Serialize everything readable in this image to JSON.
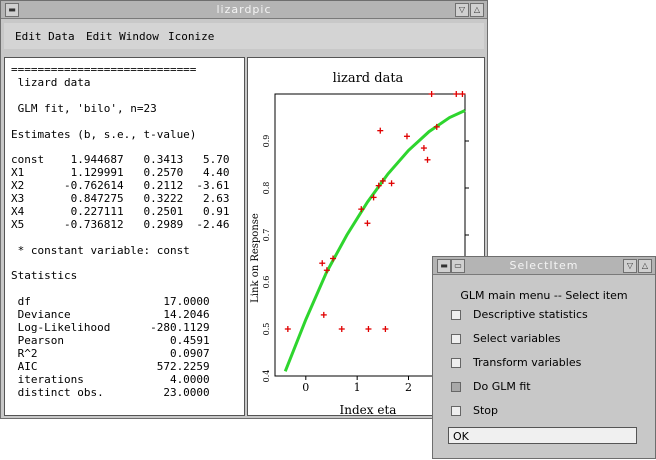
{
  "main_window": {
    "title": "lizardpic",
    "titlebar_buttons": [
      "▽",
      "△"
    ],
    "menu": [
      "Edit Data",
      "Edit Window",
      "Iconize"
    ]
  },
  "text_panel": {
    "lines": [
      "============================",
      " lizard data",
      "",
      " GLM fit, 'bilo', n=23",
      "",
      "Estimates (b, s.e., t-value)",
      "",
      "const    1.944687   0.3413   5.70",
      "X1       1.129991   0.2570   4.40",
      "X2      -0.762614   0.2112  -3.61",
      "X3       0.847275   0.3222   2.63",
      "X4       0.227111   0.2501   0.91",
      "X5      -0.736812   0.2989  -2.46",
      "",
      " * constant variable: const",
      "",
      "Statistics",
      "",
      " df                    17.0000",
      " Deviance              14.2046",
      " Log-Likelihood      -280.1129",
      " Pearson                0.4591",
      " R^2                    0.0907",
      " AIC                  572.2259",
      " iterations             4.0000",
      " distinct obs.         23.0000"
    ]
  },
  "chart_data": {
    "type": "scatter",
    "title": "lizard data",
    "xlabel": "Index eta",
    "ylabel": "Link on Response",
    "xlim": [
      -0.6,
      3.1
    ],
    "ylim": [
      0.4,
      1.0
    ],
    "x_ticks": [
      0,
      1,
      2
    ],
    "y_ticks": [
      0.4,
      0.5,
      0.6,
      0.7,
      0.8,
      0.9
    ],
    "points": [
      {
        "x": -0.35,
        "y": 0.5
      },
      {
        "x": 0.32,
        "y": 0.64
      },
      {
        "x": 0.35,
        "y": 0.53
      },
      {
        "x": 0.41,
        "y": 0.625
      },
      {
        "x": 0.53,
        "y": 0.65
      },
      {
        "x": 0.7,
        "y": 0.5
      },
      {
        "x": 1.08,
        "y": 0.755
      },
      {
        "x": 1.2,
        "y": 0.725
      },
      {
        "x": 1.22,
        "y": 0.5
      },
      {
        "x": 1.32,
        "y": 0.78
      },
      {
        "x": 1.42,
        "y": 0.805
      },
      {
        "x": 1.45,
        "y": 0.922
      },
      {
        "x": 1.5,
        "y": 0.815
      },
      {
        "x": 1.55,
        "y": 0.5
      },
      {
        "x": 1.67,
        "y": 0.81
      },
      {
        "x": 1.97,
        "y": 0.91
      },
      {
        "x": 2.3,
        "y": 0.885
      },
      {
        "x": 2.37,
        "y": 0.86
      },
      {
        "x": 2.45,
        "y": 1.0
      },
      {
        "x": 2.55,
        "y": 0.93
      },
      {
        "x": 2.93,
        "y": 1.0
      },
      {
        "x": 3.05,
        "y": 1.0
      }
    ],
    "fit_line": {
      "x": [
        -0.4,
        0.0,
        0.4,
        0.8,
        1.2,
        1.6,
        2.0,
        2.4,
        2.8,
        3.1
      ],
      "y": [
        0.41,
        0.52,
        0.62,
        0.7,
        0.77,
        0.83,
        0.88,
        0.92,
        0.95,
        0.965
      ]
    },
    "point_color": "#e00000",
    "line_color": "#2ed52e"
  },
  "dialog": {
    "title": "SelectItem",
    "titlebar_buttons": [
      "▽",
      "△"
    ],
    "heading": "GLM main menu -- Select item",
    "items": [
      {
        "label": "Descriptive statistics",
        "checked": false
      },
      {
        "label": "Select variables",
        "checked": false
      },
      {
        "label": "Transform variables",
        "checked": false
      },
      {
        "label": "Do GLM fit",
        "checked": true
      },
      {
        "label": "Stop",
        "checked": false
      }
    ],
    "ok_label": "OK"
  }
}
